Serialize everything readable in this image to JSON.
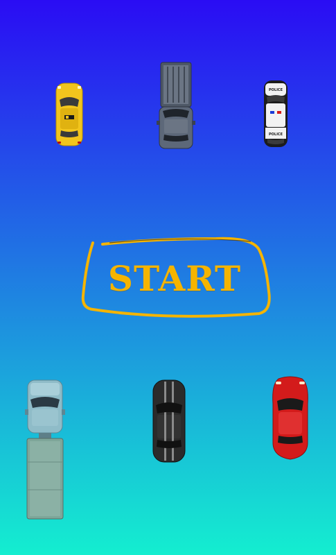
{
  "colors": {
    "background_top": "#2a0cf4",
    "background_bottom": "#14eed0",
    "accent": "#f5b400",
    "taxi": "#f2c51d",
    "pickup": "#5d6879",
    "police_black": "#1c1c1c",
    "police_white": "#f2f2f2",
    "truck": "#8fbcc8",
    "muscle_car": "#2b2b2b",
    "sports_car": "#d31b1b"
  },
  "start_button": {
    "label": "START"
  },
  "cars": [
    {
      "name": "taxi",
      "icon": "taxi-car-icon"
    },
    {
      "name": "pickup",
      "icon": "pickup-truck-icon"
    },
    {
      "name": "police",
      "icon": "police-car-icon",
      "decal": "POLICE"
    },
    {
      "name": "truck",
      "icon": "flatbed-truck-icon"
    },
    {
      "name": "muscle",
      "icon": "muscle-car-icon"
    },
    {
      "name": "sports",
      "icon": "sports-car-icon"
    }
  ]
}
